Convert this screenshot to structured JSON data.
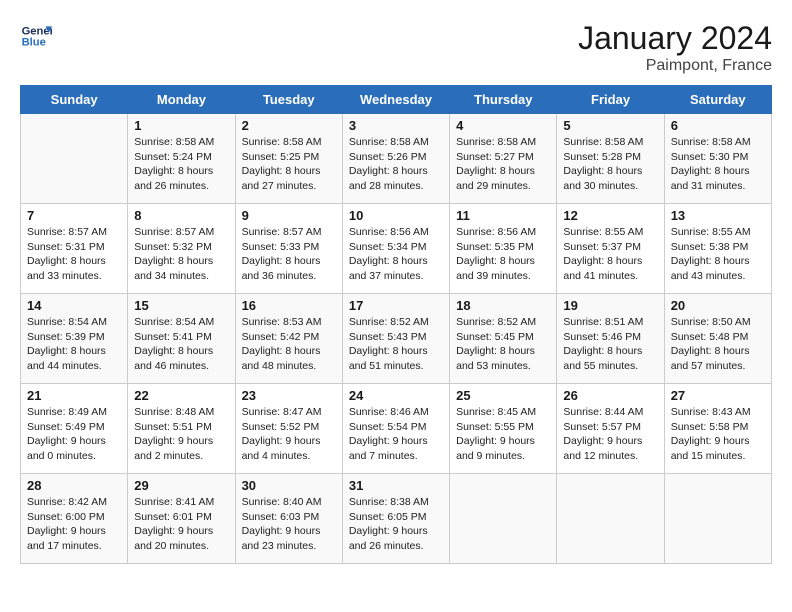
{
  "header": {
    "logo_line1": "General",
    "logo_line2": "Blue",
    "month_year": "January 2024",
    "location": "Paimpont, France"
  },
  "weekdays": [
    "Sunday",
    "Monday",
    "Tuesday",
    "Wednesday",
    "Thursday",
    "Friday",
    "Saturday"
  ],
  "weeks": [
    [
      {
        "day": "",
        "sunrise": "",
        "sunset": "",
        "daylight": ""
      },
      {
        "day": "1",
        "sunrise": "Sunrise: 8:58 AM",
        "sunset": "Sunset: 5:24 PM",
        "daylight": "Daylight: 8 hours and 26 minutes."
      },
      {
        "day": "2",
        "sunrise": "Sunrise: 8:58 AM",
        "sunset": "Sunset: 5:25 PM",
        "daylight": "Daylight: 8 hours and 27 minutes."
      },
      {
        "day": "3",
        "sunrise": "Sunrise: 8:58 AM",
        "sunset": "Sunset: 5:26 PM",
        "daylight": "Daylight: 8 hours and 28 minutes."
      },
      {
        "day": "4",
        "sunrise": "Sunrise: 8:58 AM",
        "sunset": "Sunset: 5:27 PM",
        "daylight": "Daylight: 8 hours and 29 minutes."
      },
      {
        "day": "5",
        "sunrise": "Sunrise: 8:58 AM",
        "sunset": "Sunset: 5:28 PM",
        "daylight": "Daylight: 8 hours and 30 minutes."
      },
      {
        "day": "6",
        "sunrise": "Sunrise: 8:58 AM",
        "sunset": "Sunset: 5:30 PM",
        "daylight": "Daylight: 8 hours and 31 minutes."
      }
    ],
    [
      {
        "day": "7",
        "sunrise": "Sunrise: 8:57 AM",
        "sunset": "Sunset: 5:31 PM",
        "daylight": "Daylight: 8 hours and 33 minutes."
      },
      {
        "day": "8",
        "sunrise": "Sunrise: 8:57 AM",
        "sunset": "Sunset: 5:32 PM",
        "daylight": "Daylight: 8 hours and 34 minutes."
      },
      {
        "day": "9",
        "sunrise": "Sunrise: 8:57 AM",
        "sunset": "Sunset: 5:33 PM",
        "daylight": "Daylight: 8 hours and 36 minutes."
      },
      {
        "day": "10",
        "sunrise": "Sunrise: 8:56 AM",
        "sunset": "Sunset: 5:34 PM",
        "daylight": "Daylight: 8 hours and 37 minutes."
      },
      {
        "day": "11",
        "sunrise": "Sunrise: 8:56 AM",
        "sunset": "Sunset: 5:35 PM",
        "daylight": "Daylight: 8 hours and 39 minutes."
      },
      {
        "day": "12",
        "sunrise": "Sunrise: 8:55 AM",
        "sunset": "Sunset: 5:37 PM",
        "daylight": "Daylight: 8 hours and 41 minutes."
      },
      {
        "day": "13",
        "sunrise": "Sunrise: 8:55 AM",
        "sunset": "Sunset: 5:38 PM",
        "daylight": "Daylight: 8 hours and 43 minutes."
      }
    ],
    [
      {
        "day": "14",
        "sunrise": "Sunrise: 8:54 AM",
        "sunset": "Sunset: 5:39 PM",
        "daylight": "Daylight: 8 hours and 44 minutes."
      },
      {
        "day": "15",
        "sunrise": "Sunrise: 8:54 AM",
        "sunset": "Sunset: 5:41 PM",
        "daylight": "Daylight: 8 hours and 46 minutes."
      },
      {
        "day": "16",
        "sunrise": "Sunrise: 8:53 AM",
        "sunset": "Sunset: 5:42 PM",
        "daylight": "Daylight: 8 hours and 48 minutes."
      },
      {
        "day": "17",
        "sunrise": "Sunrise: 8:52 AM",
        "sunset": "Sunset: 5:43 PM",
        "daylight": "Daylight: 8 hours and 51 minutes."
      },
      {
        "day": "18",
        "sunrise": "Sunrise: 8:52 AM",
        "sunset": "Sunset: 5:45 PM",
        "daylight": "Daylight: 8 hours and 53 minutes."
      },
      {
        "day": "19",
        "sunrise": "Sunrise: 8:51 AM",
        "sunset": "Sunset: 5:46 PM",
        "daylight": "Daylight: 8 hours and 55 minutes."
      },
      {
        "day": "20",
        "sunrise": "Sunrise: 8:50 AM",
        "sunset": "Sunset: 5:48 PM",
        "daylight": "Daylight: 8 hours and 57 minutes."
      }
    ],
    [
      {
        "day": "21",
        "sunrise": "Sunrise: 8:49 AM",
        "sunset": "Sunset: 5:49 PM",
        "daylight": "Daylight: 9 hours and 0 minutes."
      },
      {
        "day": "22",
        "sunrise": "Sunrise: 8:48 AM",
        "sunset": "Sunset: 5:51 PM",
        "daylight": "Daylight: 9 hours and 2 minutes."
      },
      {
        "day": "23",
        "sunrise": "Sunrise: 8:47 AM",
        "sunset": "Sunset: 5:52 PM",
        "daylight": "Daylight: 9 hours and 4 minutes."
      },
      {
        "day": "24",
        "sunrise": "Sunrise: 8:46 AM",
        "sunset": "Sunset: 5:54 PM",
        "daylight": "Daylight: 9 hours and 7 minutes."
      },
      {
        "day": "25",
        "sunrise": "Sunrise: 8:45 AM",
        "sunset": "Sunset: 5:55 PM",
        "daylight": "Daylight: 9 hours and 9 minutes."
      },
      {
        "day": "26",
        "sunrise": "Sunrise: 8:44 AM",
        "sunset": "Sunset: 5:57 PM",
        "daylight": "Daylight: 9 hours and 12 minutes."
      },
      {
        "day": "27",
        "sunrise": "Sunrise: 8:43 AM",
        "sunset": "Sunset: 5:58 PM",
        "daylight": "Daylight: 9 hours and 15 minutes."
      }
    ],
    [
      {
        "day": "28",
        "sunrise": "Sunrise: 8:42 AM",
        "sunset": "Sunset: 6:00 PM",
        "daylight": "Daylight: 9 hours and 17 minutes."
      },
      {
        "day": "29",
        "sunrise": "Sunrise: 8:41 AM",
        "sunset": "Sunset: 6:01 PM",
        "daylight": "Daylight: 9 hours and 20 minutes."
      },
      {
        "day": "30",
        "sunrise": "Sunrise: 8:40 AM",
        "sunset": "Sunset: 6:03 PM",
        "daylight": "Daylight: 9 hours and 23 minutes."
      },
      {
        "day": "31",
        "sunrise": "Sunrise: 8:38 AM",
        "sunset": "Sunset: 6:05 PM",
        "daylight": "Daylight: 9 hours and 26 minutes."
      },
      {
        "day": "",
        "sunrise": "",
        "sunset": "",
        "daylight": ""
      },
      {
        "day": "",
        "sunrise": "",
        "sunset": "",
        "daylight": ""
      },
      {
        "day": "",
        "sunrise": "",
        "sunset": "",
        "daylight": ""
      }
    ]
  ]
}
